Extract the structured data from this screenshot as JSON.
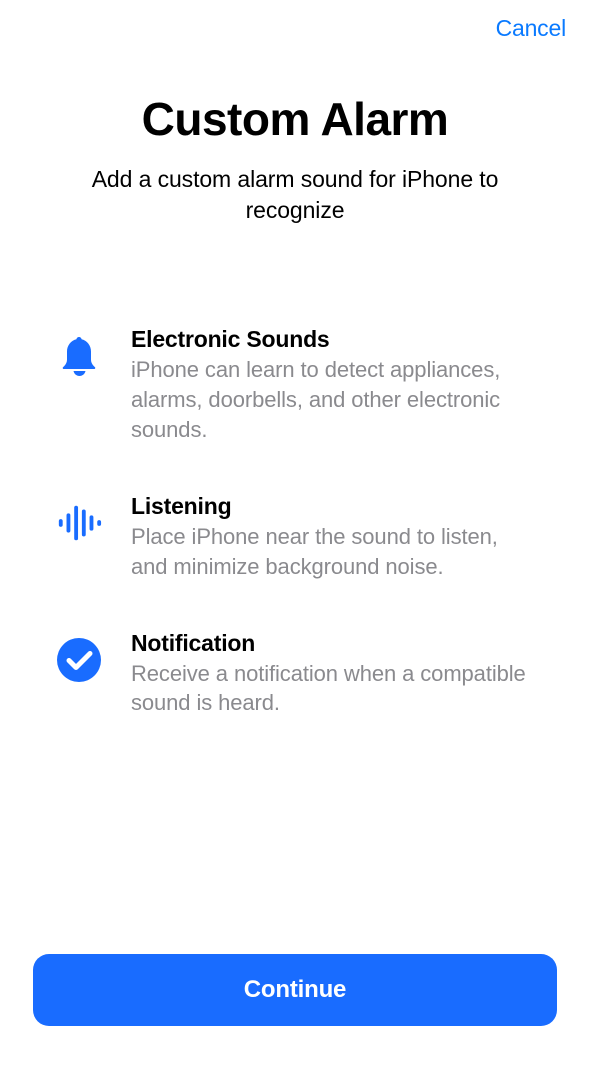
{
  "nav": {
    "cancel": "Cancel"
  },
  "header": {
    "title": "Custom Alarm",
    "subtitle": "Add a custom alarm sound for iPhone to recognize"
  },
  "features": [
    {
      "icon": "bell",
      "title": "Electronic Sounds",
      "desc": "iPhone can learn to detect appliances, alarms, doorbells, and other electronic sounds."
    },
    {
      "icon": "waveform",
      "title": "Listening",
      "desc": "Place iPhone near the sound to listen, and minimize background noise."
    },
    {
      "icon": "checkmark-circle",
      "title": "Notification",
      "desc": "Receive a notification when a compatible sound is heard."
    }
  ],
  "cta": {
    "continue": "Continue"
  },
  "colors": {
    "accent": "#196cff",
    "link": "#0a7aff",
    "muted": "#8a8a8e"
  }
}
